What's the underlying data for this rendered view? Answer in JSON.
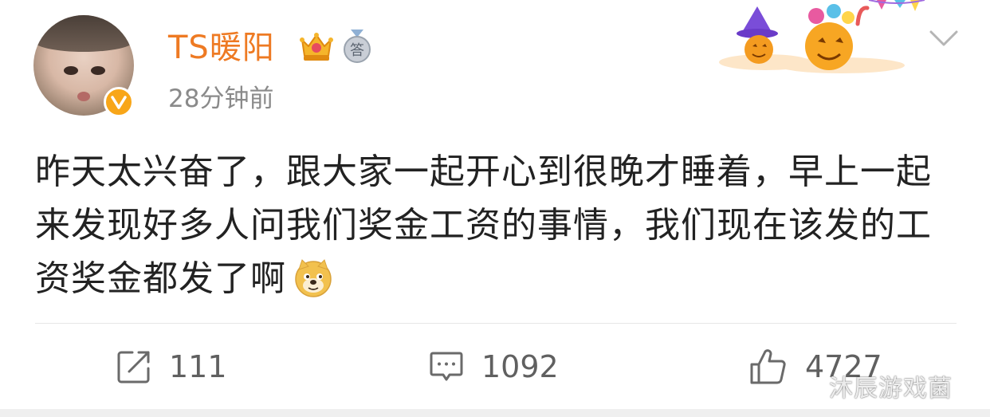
{
  "post": {
    "user": {
      "name": "TS暖阳",
      "verified": true,
      "accent_color": "#ee7a23"
    },
    "badges": [
      "crown-icon",
      "answer-medal-icon"
    ],
    "answer_badge_char": "答",
    "time": "28分钟前",
    "text": "昨天太兴奋了，跟大家一起开心到很晚才睡着，早上一起来发现好多人问我们奖金工资的事情，我们现在该发的工资奖金都发了啊",
    "emoji": "doge-emoji",
    "stats": {
      "reposts": "111",
      "comments": "1092",
      "likes": "4727"
    }
  },
  "watermark": "沐辰游戏菌",
  "colors": {
    "text": "#222222",
    "muted": "#8a8a8a",
    "badge": "#f8a619"
  }
}
